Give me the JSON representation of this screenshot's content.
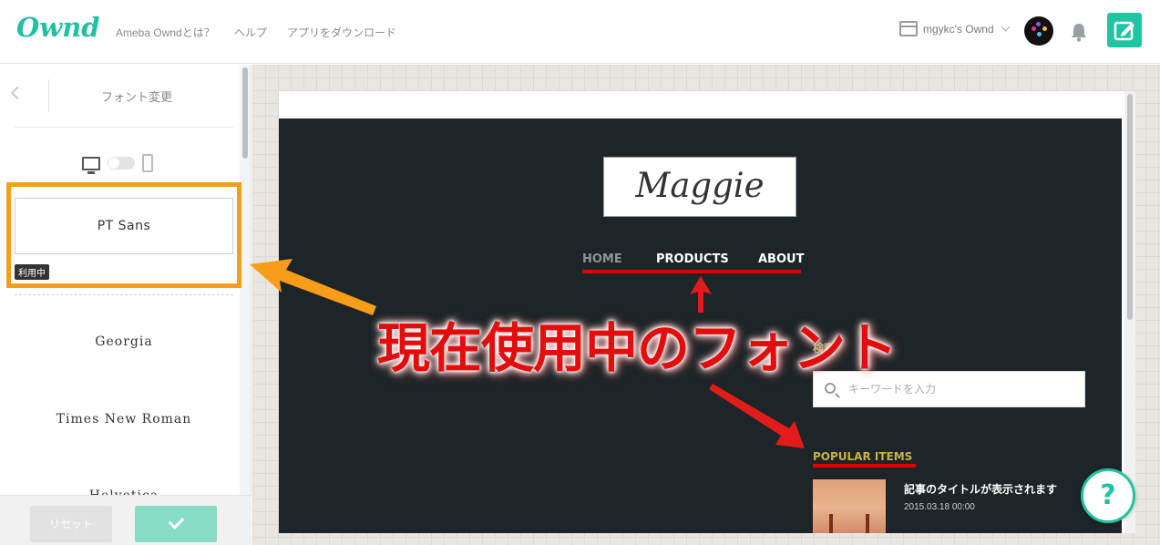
{
  "header": {
    "logo": "Ownd",
    "nav": [
      "Ameba Owndとは？",
      "ヘルプ",
      "アプリをダウンロード"
    ],
    "site_name": "mgykc's Ownd"
  },
  "sidebar": {
    "title": "フォント変更",
    "selected_font": "PT Sans",
    "in_use_badge": "利用中",
    "fonts": [
      "Georgia",
      "Times New Roman",
      "Helvetica"
    ],
    "reset_label": "リセット"
  },
  "preview": {
    "site_logo": "Maggie",
    "nav": [
      "HOME",
      "PRODUCTS",
      "ABOUT"
    ],
    "search_label": "検索",
    "search_placeholder": "キーワードを入力",
    "popular_heading": "POPULAR ITEMS",
    "article_title": "記事のタイトルが表示されます",
    "article_date": "2015.03.18 00:00"
  },
  "annotation": {
    "caption": "現在使用中のフォント"
  },
  "help_label": "?",
  "colors": {
    "brand": "#21c0a5",
    "highlight_orange": "#f79d1a",
    "annotation_red": "#e40d0d",
    "preview_dark": "#1d2528",
    "nav_active_gray": "#8d9396",
    "popular_gold": "#c9b14a"
  }
}
